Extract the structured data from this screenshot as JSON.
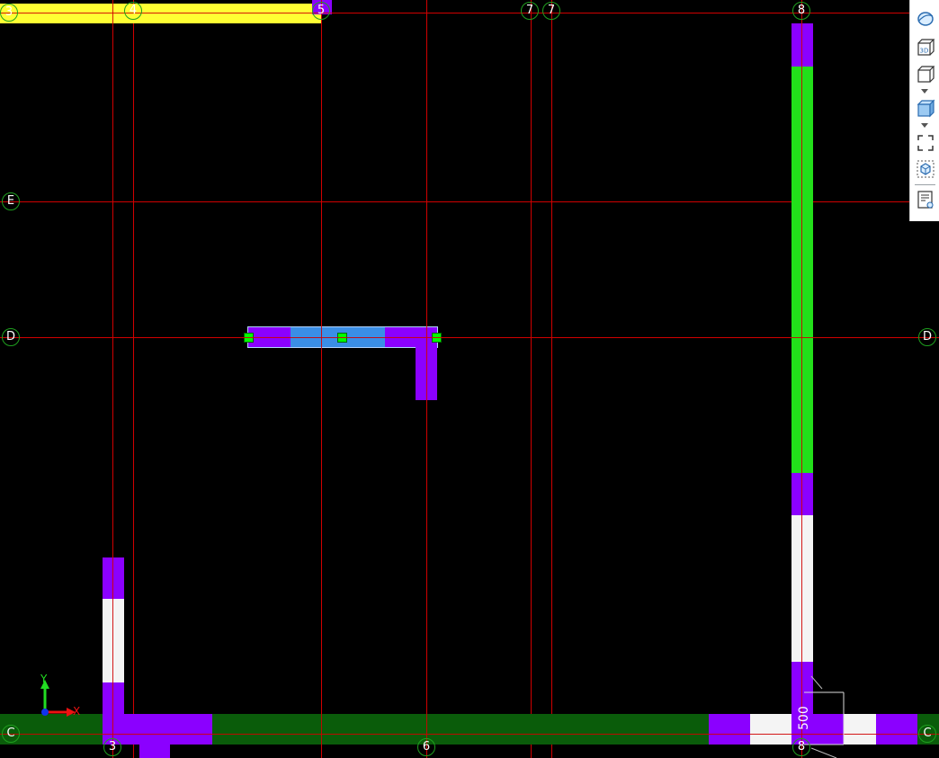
{
  "grid_axes": {
    "vertical_labels": [
      "3",
      "4",
      "5",
      "6",
      "7",
      "7",
      "8"
    ],
    "horizontal_labels": [
      "E",
      "D",
      "D",
      "C",
      "C"
    ],
    "bottom_labels": [
      "3",
      "6",
      "8"
    ]
  },
  "dimension": {
    "text": "500"
  },
  "ucs": {
    "x_label": "X",
    "y_label": "Y"
  },
  "toolbar": {
    "items": [
      "orbit-icon",
      "3d-view-icon",
      "view-cube-icon",
      "display-mode-icon",
      "zoom-extents-icon",
      "isolate-icon",
      "properties-icon"
    ],
    "icon_text_3d": "3D"
  },
  "colors": {
    "background": "#000000",
    "grid_line": "#d00000",
    "column": "#8b00ff",
    "wall_white": "#f4f4f4",
    "wall_green": "#22e01a",
    "beam_dark_green": "#0a5c0a",
    "beam_yellow": "#ffff33",
    "selected_blue": "#3a8ee6",
    "grip": "#00ff00"
  }
}
